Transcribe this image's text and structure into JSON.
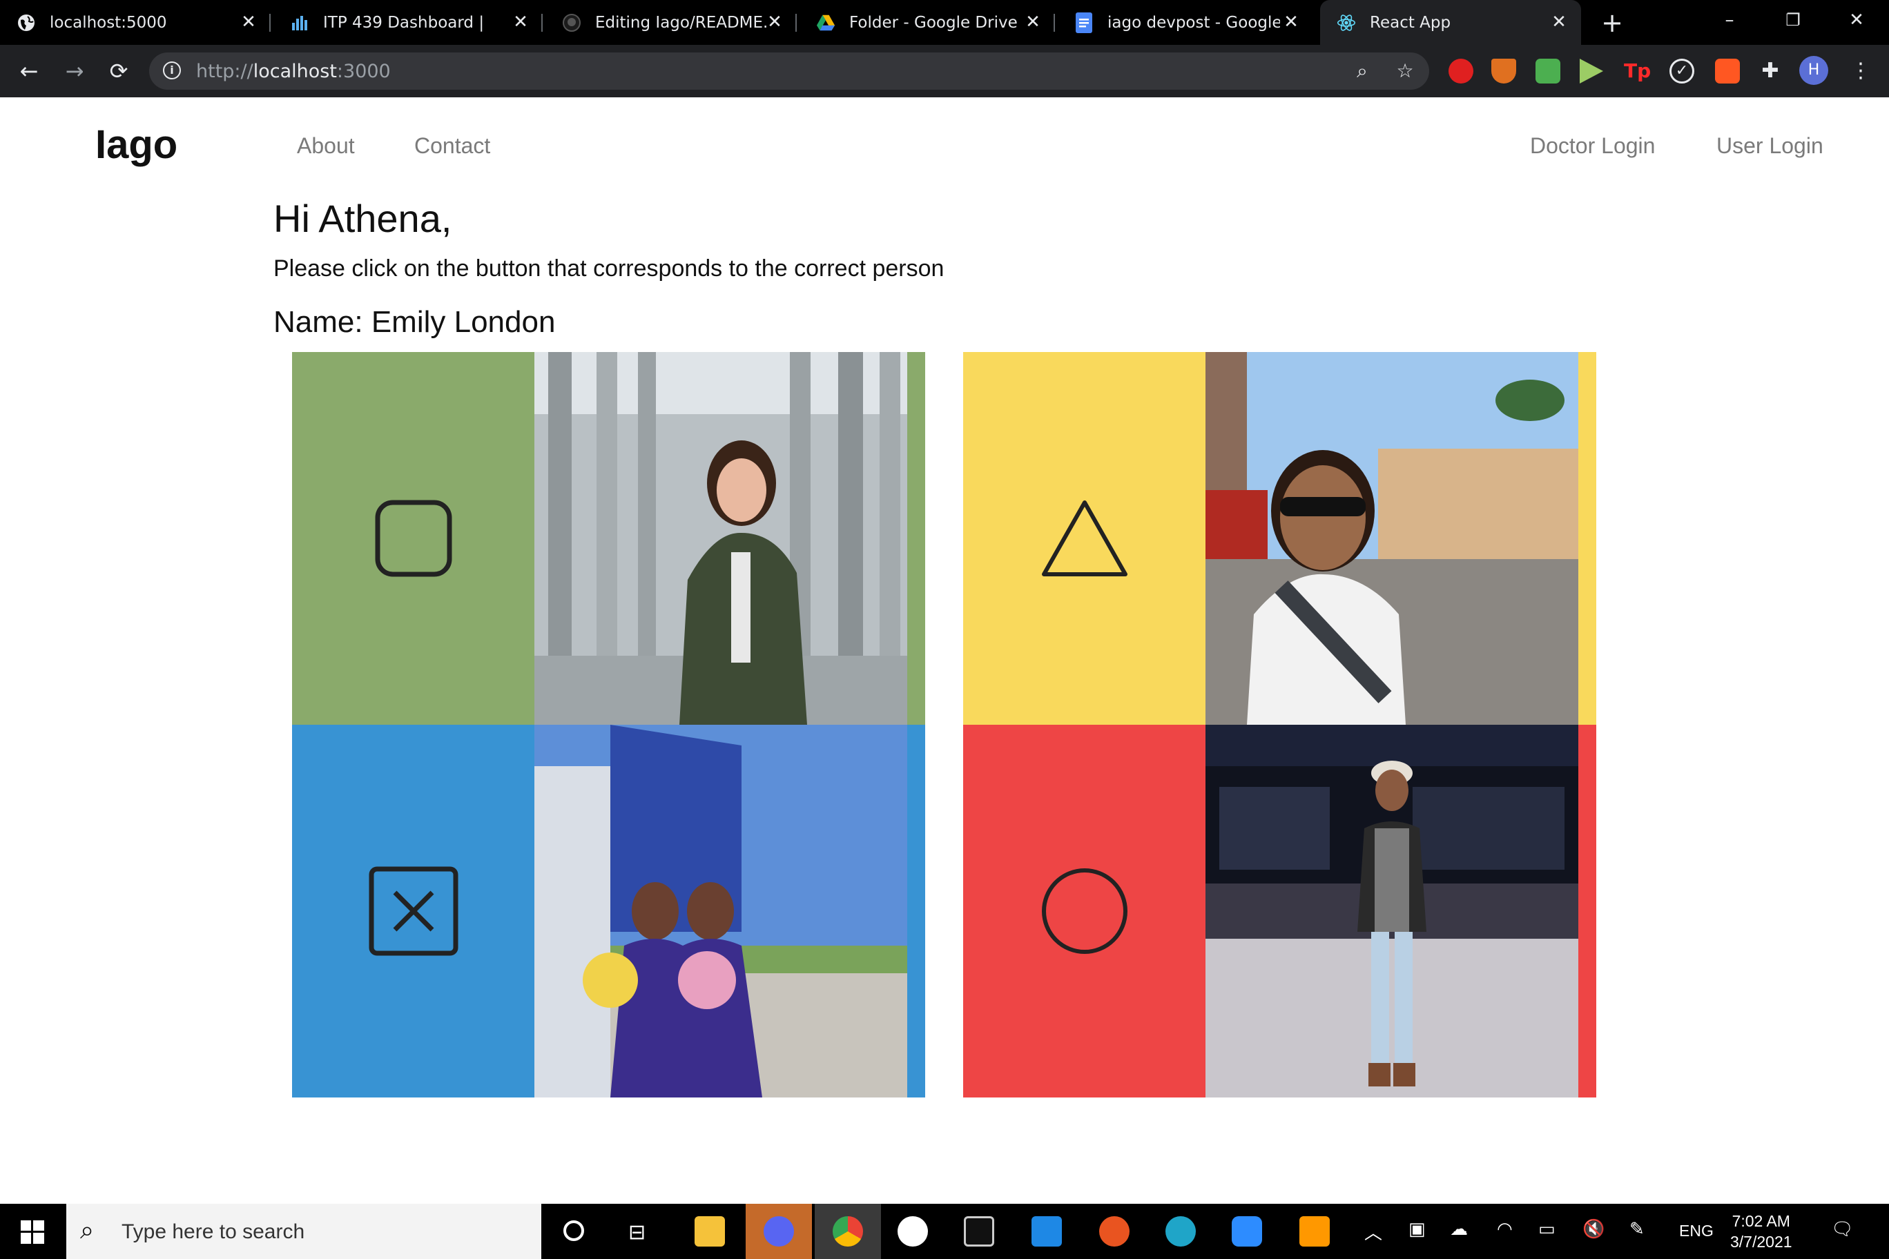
{
  "browser": {
    "tabs": [
      {
        "title": "localhost:5000",
        "active": false
      },
      {
        "title": "ITP 439 Dashboard | Gra",
        "active": false
      },
      {
        "title": "Editing Iago/README.m",
        "active": false
      },
      {
        "title": "Folder - Google Drive",
        "active": false
      },
      {
        "title": "iago devpost - Google D",
        "active": false
      },
      {
        "title": "React App",
        "active": true
      }
    ],
    "url": {
      "scheme": "http://",
      "host": "localhost",
      "port": ":3000"
    },
    "avatar_letter": "H"
  },
  "page": {
    "brand": "Iago",
    "nav_left": [
      "About",
      "Contact"
    ],
    "nav_right": [
      "Doctor Login",
      "User Login"
    ],
    "greeting": "Hi Athena,",
    "instruction": "Please click on the button that corresponds to the correct person",
    "name_line": "Name: Emily London",
    "options": [
      {
        "shape": "square-icon",
        "color": "#8aaa6b"
      },
      {
        "shape": "triangle-icon",
        "color": "#f9d95c"
      },
      {
        "shape": "x-box-icon",
        "color": "#3893d3"
      },
      {
        "shape": "circle-icon",
        "color": "#ee4545"
      }
    ]
  },
  "taskbar": {
    "search_placeholder": "Type here to search",
    "language": "ENG",
    "time": "7:02 AM",
    "date": "3/7/2021"
  }
}
